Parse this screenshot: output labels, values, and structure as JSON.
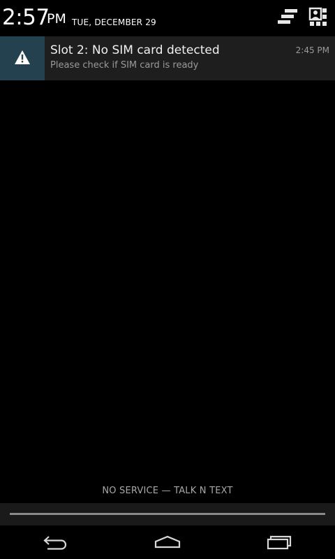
{
  "header": {
    "time": "2:57",
    "ampm": "PM",
    "date": "TUE, DECEMBER 29",
    "clear_icon": "clear-all-icon",
    "settings_icon": "quick-settings-icon"
  },
  "notification": {
    "icon": "warning-icon",
    "title": "Slot 2: No SIM card detected",
    "text": "Please check if SIM card is ready",
    "time": "2:45 PM"
  },
  "carrier": {
    "label": "NO SERVICE — TALK N TEXT"
  },
  "navbar": {
    "back_icon": "back-icon",
    "home_icon": "home-icon",
    "recents_icon": "recent-apps-icon"
  },
  "colors": {
    "background": "#000000",
    "notification_bg": "#1e1e1e",
    "notification_icon_bg": "#24414f",
    "text_primary": "#f0f0f0",
    "text_secondary": "#9a9a9a"
  }
}
